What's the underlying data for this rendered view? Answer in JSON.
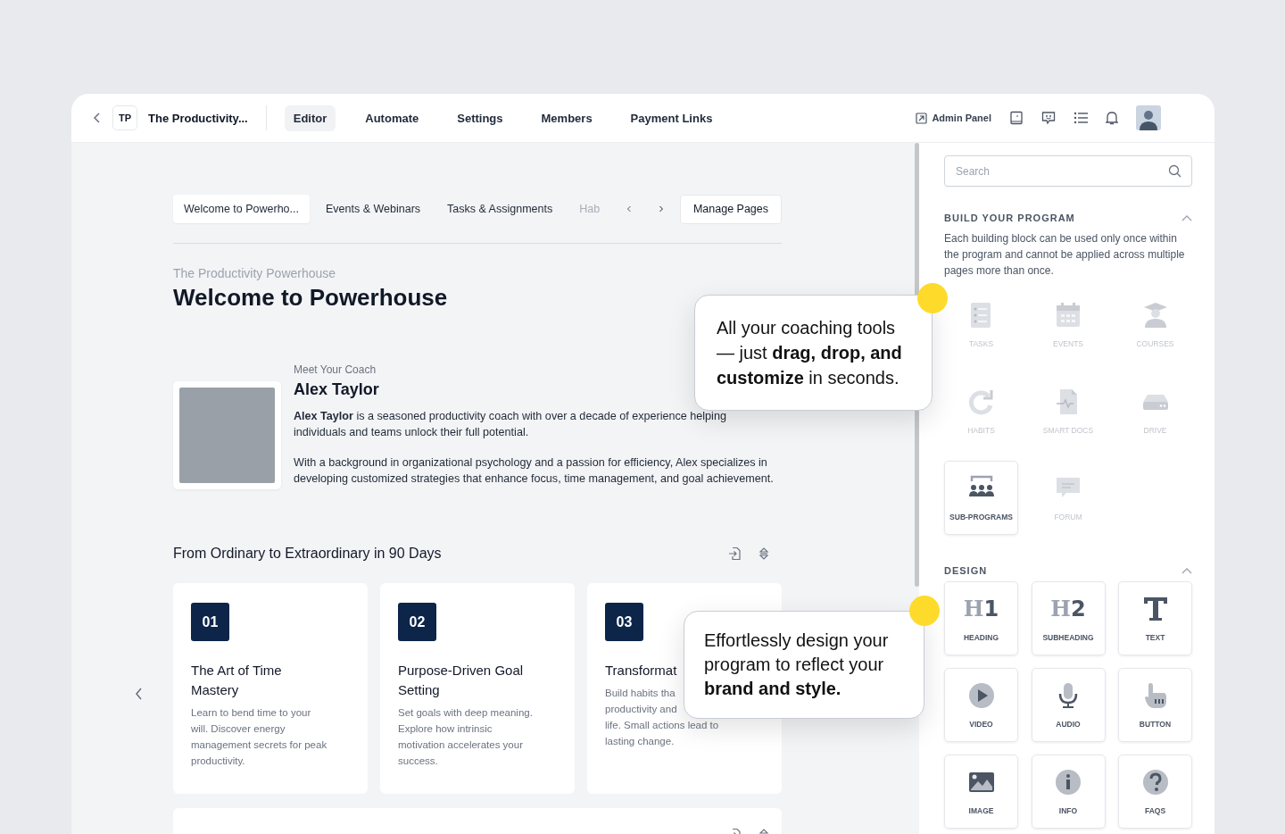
{
  "header": {
    "badge": "TP",
    "program_name": "The Productivity...",
    "nav": [
      {
        "label": "Editor",
        "selected": true
      },
      {
        "label": "Automate",
        "selected": false
      },
      {
        "label": "Settings",
        "selected": false
      },
      {
        "label": "Members",
        "selected": false
      },
      {
        "label": "Payment Links",
        "selected": false
      }
    ],
    "admin_link": "Admin Panel"
  },
  "page_tabs": [
    {
      "label": "Welcome to Powerho...",
      "selected": true,
      "faded": false
    },
    {
      "label": "Events & Webinars",
      "selected": false,
      "faded": false
    },
    {
      "label": "Tasks & Assignments",
      "selected": false,
      "faded": false
    },
    {
      "label": "Hab",
      "selected": false,
      "faded": true
    }
  ],
  "manage_button": "Manage Pages",
  "subtitle": "The Productivity Powerhouse",
  "title": "Welcome to Powerhouse",
  "coach": {
    "eyebrow": "Meet Your Coach",
    "name": "Alex Taylor",
    "paragraphs": [
      "**Alex Taylor** is a seasoned productivity coach with over a decade of experience helping individuals and teams unlock their full potential.",
      "With a background in organizational psychology and a passion for efficiency, Alex specializes in developing customized strategies that enhance focus, time management, and goal achievement."
    ]
  },
  "steps_section": {
    "title": "From Ordinary to Extraordinary in 90 Days",
    "cards": [
      {
        "number": "01",
        "title": "The Art of Time Mastery",
        "lines": [
          "Learn to bend time to your",
          "will. Discover energy",
          "management secrets for peak",
          "productivity."
        ]
      },
      {
        "number": "02",
        "title": "Purpose-Driven Goal Setting",
        "lines": [
          "Set goals with deep meaning.",
          "Explore how intrinsic",
          "motivation accelerates your",
          "success."
        ]
      },
      {
        "number": "03",
        "title": "Transformat",
        "lines": [
          "Build habits tha",
          "productivity and",
          "life. Small actions lead to",
          "lasting change."
        ]
      }
    ]
  },
  "sidebar": {
    "search": {
      "placeholder": "Search"
    },
    "build": {
      "title": "BUILD YOUR PROGRAM",
      "expanded": true,
      "note": "Each building block can be used only once within the program and cannot be applied across multiple pages more than once.",
      "blocks": [
        {
          "label": "TASKS",
          "enabled": false
        },
        {
          "label": "EVENTS",
          "enabled": false
        },
        {
          "label": "COURSES",
          "enabled": false
        },
        {
          "label": "HABITS",
          "enabled": false
        },
        {
          "label": "SMART DOCS",
          "enabled": false
        },
        {
          "label": "DRIVE",
          "enabled": false
        },
        {
          "label": "SUB-PROGRAMS",
          "enabled": true
        },
        {
          "label": "FORUM",
          "enabled": false
        }
      ]
    },
    "design": {
      "title": "DESIGN",
      "expanded": true,
      "blocks": [
        {
          "label": "HEADING",
          "enabled": true,
          "glyph": [
            "H",
            "1"
          ]
        },
        {
          "label": "SUBHEADING",
          "enabled": true,
          "glyph": [
            "H",
            "2"
          ]
        },
        {
          "label": "TEXT",
          "enabled": true
        },
        {
          "label": "VIDEO",
          "enabled": true
        },
        {
          "label": "AUDIO",
          "enabled": true
        },
        {
          "label": "BUTTON",
          "enabled": true
        },
        {
          "label": "IMAGE",
          "enabled": true
        },
        {
          "label": "INFO",
          "enabled": true
        },
        {
          "label": "FAQS",
          "enabled": true
        }
      ]
    }
  },
  "callouts": [
    "All your coaching tools — just **drag, drop, and customize** in seconds.",
    "Effortlessly design your program to reflect your **brand and style.**"
  ]
}
